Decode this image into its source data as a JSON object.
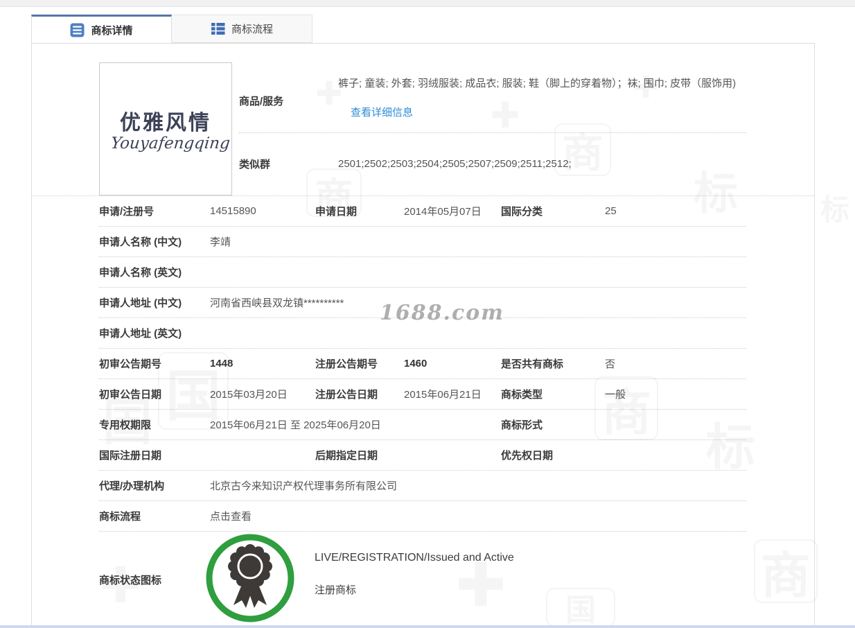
{
  "colors": {
    "accent": "#5574ac",
    "link": "#2b8cd8",
    "badge_green": "#2f9e3e",
    "badge_dark": "#3d3a37"
  },
  "tabs": [
    {
      "label": "商标详情",
      "active": true
    },
    {
      "label": "商标流程",
      "active": false
    }
  ],
  "mark": {
    "cn": "优雅风情",
    "en": "Youyafengqing"
  },
  "top": {
    "goods_label": "商品/服务",
    "goods_value": "裤子; 童装; 外套; 羽绒服装; 成品衣; 服装; 鞋（脚上的穿着物）；袜; 围巾; 皮带（服饰用)",
    "goods_link": "查看详细信息",
    "similar_label": "类似群",
    "similar_value": "2501;2502;2503;2504;2505;2507;2509;2511;2512;"
  },
  "rows": [
    {
      "cols": [
        {
          "label": "申请/注册号",
          "value": "14515890"
        },
        {
          "label": "申请日期",
          "value": "2014年05月07日"
        },
        {
          "label": "国际分类",
          "value": "25"
        }
      ]
    },
    {
      "cols": [
        {
          "label": "申请人名称 (中文)",
          "value": "李靖"
        }
      ]
    },
    {
      "cols": [
        {
          "label": "申请人名称 (英文)",
          "value": ""
        }
      ]
    },
    {
      "cols": [
        {
          "label": "申请人地址 (中文)",
          "value": "河南省西峡县双龙镇**********"
        }
      ]
    },
    {
      "cols": [
        {
          "label": "申请人地址 (英文)",
          "value": ""
        }
      ]
    },
    {
      "cols": [
        {
          "label": "初审公告期号",
          "value": "1448",
          "bold": true
        },
        {
          "label": "注册公告期号",
          "value": "1460",
          "bold": true
        },
        {
          "label": "是否共有商标",
          "value": "否"
        }
      ]
    },
    {
      "cols": [
        {
          "label": "初审公告日期",
          "value": "2015年03月20日"
        },
        {
          "label": "注册公告日期",
          "value": "2015年06月21日"
        },
        {
          "label": "商标类型",
          "value": "一般"
        }
      ]
    },
    {
      "cols": [
        {
          "label": "专用权期限",
          "value": "2015年06月21日 至 2025年06月20日",
          "span": true
        },
        {
          "label": "商标形式",
          "value": ""
        }
      ]
    },
    {
      "cols": [
        {
          "label": "国际注册日期",
          "value": ""
        },
        {
          "label": "后期指定日期",
          "value": ""
        },
        {
          "label": "优先权日期",
          "value": ""
        }
      ]
    },
    {
      "cols": [
        {
          "label": "代理/办理机构",
          "value": "北京古今来知识产权代理事务所有限公司"
        }
      ]
    },
    {
      "cols": [
        {
          "label": "商标流程",
          "value": "点击查看",
          "link": true
        }
      ]
    }
  ],
  "status": {
    "label": "商标状态图标",
    "line1": "LIVE/REGISTRATION/Issued and Active",
    "line2": "注册商标"
  },
  "watermark": "1688.com"
}
